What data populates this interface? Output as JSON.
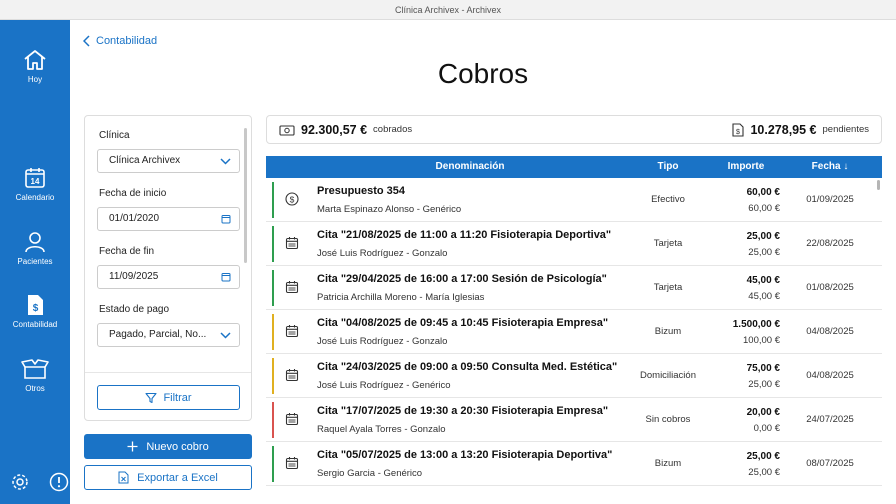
{
  "window": {
    "title": "Clínica Archivex - Archivex"
  },
  "sidebar": {
    "items": [
      {
        "label": "Hoy",
        "icon": "home-icon"
      },
      {
        "label": "Calendario",
        "icon": "calendar-icon",
        "badge": "14"
      },
      {
        "label": "Pacientes",
        "icon": "user-icon"
      },
      {
        "label": "Contabilidad",
        "icon": "document-dollar-icon"
      },
      {
        "label": "Otros",
        "icon": "box-icon"
      }
    ],
    "bottom_icons": [
      "gear-icon",
      "info-icon"
    ]
  },
  "breadcrumb": {
    "back_label": "Contabilidad"
  },
  "page": {
    "title": "Cobros"
  },
  "filters": {
    "clinic_label": "Clínica",
    "clinic_value": "Clínica Archivex",
    "start_label": "Fecha de inicio",
    "start_value": "01/01/2020",
    "end_label": "Fecha de fin",
    "end_value": "11/09/2025",
    "status_label": "Estado de pago",
    "status_value": "Pagado, Parcial, No...",
    "filter_button": "Filtrar"
  },
  "actions": {
    "new_label": "Nuevo cobro",
    "export_label": "Exportar a Excel"
  },
  "summary": {
    "collected_amount": "92.300,57 €",
    "collected_label": "cobrados",
    "pending_amount": "10.278,95 €",
    "pending_label": "pendientes"
  },
  "table": {
    "headers": {
      "name": "Denominación",
      "type": "Tipo",
      "amount": "Importe",
      "date": "Fecha ↓"
    },
    "rows": [
      {
        "title": "Presupuesto 354",
        "subtitle": "Marta Espinazo Alonso - Genérico",
        "type": "Efectivo",
        "amount": "60,00 €",
        "paid": "60,00 €",
        "date": "01/09/2025",
        "status_color": "#2e9e4f",
        "icon": "dollar-circle-icon"
      },
      {
        "title": "Cita \"21/08/2025 de 11:00 a 11:20 Fisioterapia Deportiva\"",
        "subtitle": "José Luis Rodríguez - Gonzalo",
        "type": "Tarjeta",
        "amount": "25,00 €",
        "paid": "25,00 €",
        "date": "22/08/2025",
        "status_color": "#2e9e4f",
        "icon": "calendar-icon"
      },
      {
        "title": "Cita \"29/04/2025 de 16:00 a 17:00 Sesión de Psicología\"",
        "subtitle": "Patricia Archilla Moreno - María Iglesias",
        "type": "Tarjeta",
        "amount": "45,00 €",
        "paid": "45,00 €",
        "date": "01/08/2025",
        "status_color": "#2e9e4f",
        "icon": "calendar-icon"
      },
      {
        "title": "Cita \"04/08/2025 de 09:45 a 10:45 Fisioterapia Empresa\"",
        "subtitle": "José Luis Rodríguez - Gonzalo",
        "type": "Bizum",
        "amount": "1.500,00 €",
        "paid": "100,00 €",
        "date": "04/08/2025",
        "status_color": "#e0b020",
        "icon": "calendar-icon"
      },
      {
        "title": "Cita \"24/03/2025 de 09:00 a 09:50 Consulta Med. Estética\"",
        "subtitle": "José Luis Rodríguez - Genérico",
        "type": "Domiciliación",
        "amount": "75,00 €",
        "paid": "25,00 €",
        "date": "04/08/2025",
        "status_color": "#e0b020",
        "icon": "calendar-icon"
      },
      {
        "title": "Cita \"17/07/2025 de 19:30 a 20:30 Fisioterapia Empresa\"",
        "subtitle": "Raquel Ayala Torres - Gonzalo",
        "type": "Sin cobros",
        "amount": "20,00 €",
        "paid": "0,00 €",
        "date": "24/07/2025",
        "status_color": "#d9534f",
        "icon": "calendar-icon"
      },
      {
        "title": "Cita \"05/07/2025 de 13:00 a 13:20 Fisioterapia Deportiva\"",
        "subtitle": "Sergio Garcia - Genérico",
        "type": "Bizum",
        "amount": "25,00 €",
        "paid": "25,00 €",
        "date": "08/07/2025",
        "status_color": "#2e9e4f",
        "icon": "calendar-icon"
      }
    ]
  },
  "colors": {
    "accent": "#1a73c6"
  }
}
